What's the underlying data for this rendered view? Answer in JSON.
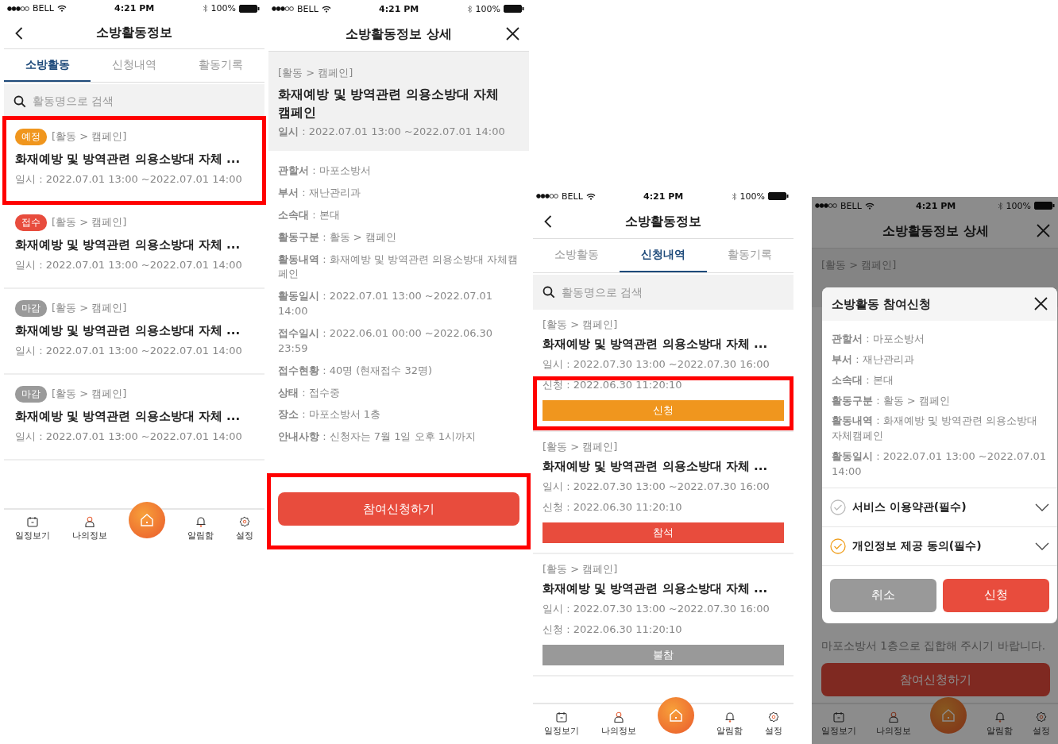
{
  "screens": [
    {
      "kind": "list",
      "status_bar": {
        "carrier": "BELL",
        "time": "4:21 PM",
        "battery": "100%"
      },
      "header": {
        "title": "소방활동정보"
      },
      "tabs": [
        {
          "label": "소방활동",
          "selected": true
        },
        {
          "label": "신청내역",
          "selected": false
        },
        {
          "label": "활동기록",
          "selected": false
        }
      ],
      "search": {
        "placeholder": "활동명으로 검색"
      },
      "items": [
        {
          "badge": "예정",
          "color": "#f0961e",
          "category": "[활동 > 캠페인]",
          "title": "화재예방 및 방역관련 의용소방대 자체 ...",
          "date": "일시 : 2022.07.01 13:00 ~2022.07.01 14:00",
          "highlighted": true
        },
        {
          "badge": "접수",
          "color": "#e84c3d",
          "category": "[활동 > 캠페인]",
          "title": "화재예방 및 방역관련 의용소방대 자체 ...",
          "date": "일시 : 2022.07.01 13:00 ~2022.07.01 14:00",
          "highlighted": false
        },
        {
          "badge": "마감",
          "color": "#9a9a9a",
          "category": "[활동 > 캠페인]",
          "title": "화재예방 및 방역관련 의용소방대 자체 ...",
          "date": "일시 : 2022.07.01 13:00 ~2022.07.01 14:00",
          "highlighted": false
        },
        {
          "badge": "마감",
          "color": "#9a9a9a",
          "category": "[활동 > 캠페인]",
          "title": "화재예방 및 방역관련 의용소방대 자체 ...",
          "date": "일시 : 2022.07.01 13:00 ~2022.07.01 14:00",
          "highlighted": false
        }
      ],
      "nav": [
        {
          "kind": "calendar",
          "label": "일정보기"
        },
        {
          "kind": "person",
          "label": "나의정보"
        },
        {
          "kind": "home"
        },
        {
          "kind": "bell",
          "label": "알림함"
        },
        {
          "kind": "gear",
          "label": "설정"
        }
      ]
    },
    {
      "kind": "detail",
      "status_bar": {
        "carrier": "BELL",
        "time": "4:21 PM",
        "battery": "100%"
      },
      "header": {
        "title": "소방활동정보 상세"
      },
      "summary": {
        "category": "[활동 > 캠페인]",
        "title": "화재예방 및 방역관련 의용소방대 자체 캠페인",
        "date": "**일시** : 2022.07.01 13:00 ~2022.07.01 14:00"
      },
      "fields": [
        "**관할서** : 마포소방서",
        "**부서** : 재난관리과",
        "**소속대** : 본대",
        "**활동구분** : 활동 > 캠페인",
        "**활동내역** : 화재예방 및 방역관련 의용소방대 자체캠페인",
        "**활동일시** : 2022.07.01 13:00 ~2022.07.01 14:00",
        "**접수일시** : 2022.06.01 00:00 ~2022.06.30 23:59",
        "**접수현황** : 40명 (현재접수 32명)",
        "**상태** : 접수중",
        "**장소** : 마포소방서 1층",
        "**안내사항** : 신청자는 7월 1일 오후 1시까지"
      ],
      "action": {
        "label": "참여신청하기",
        "highlighted": true
      }
    },
    {
      "kind": "applied",
      "status_bar": {
        "carrier": "BELL",
        "time": "4:21 PM",
        "battery": "100%"
      },
      "header": {
        "title": "소방활동정보"
      },
      "tabs": [
        {
          "label": "소방활동",
          "selected": false
        },
        {
          "label": "신청내역",
          "selected": true
        },
        {
          "label": "활동기록",
          "selected": false
        }
      ],
      "search": {
        "placeholder": "활동명으로 검색"
      },
      "items": [
        {
          "category": "[활동 > 캠페인]",
          "title": "화재예방 및 방역관련 의용소방대 자체 ...",
          "date": "일시 : 2022.07.30 13:00 ~2022.07.30 16:00",
          "applied": "신청 : 2022.06.30 11:20:10",
          "status": "신청",
          "color": "#f0961e",
          "highlighted": true
        },
        {
          "category": "[활동 > 캠페인]",
          "title": "화재예방 및 방역관련 의용소방대 자체 ...",
          "date": "일시 : 2022.07.30 13:00 ~2022.07.30 16:00",
          "applied": "신청 : 2022.06.30 11:20:10",
          "status": "참석",
          "color": "#e84c3d",
          "highlighted": false
        },
        {
          "category": "[활동 > 캠페인]",
          "title": "화재예방 및 방역관련 의용소방대 자체 ...",
          "date": "일시 : 2022.07.30 13:00 ~2022.07.30 16:00",
          "applied": "신청 : 2022.06.30 11:20:10",
          "status": "불참",
          "color": "#999999",
          "highlighted": false
        }
      ],
      "nav": [
        {
          "kind": "calendar",
          "label": "일정보기"
        },
        {
          "kind": "person",
          "label": "나의정보"
        },
        {
          "kind": "home"
        },
        {
          "kind": "bell",
          "label": "알림함"
        },
        {
          "kind": "gear",
          "label": "설정"
        }
      ]
    },
    {
      "kind": "dialog",
      "status_bar": {
        "carrier": "BELL",
        "time": "4:21 PM",
        "battery": "100%"
      },
      "header": {
        "title": "소방활동정보 상세"
      },
      "background": {
        "category": "[활동 > 캠페인]",
        "notice": "마포소방서 1층으로 집합해 주시기 바랍니다.",
        "action": "참여신청하기"
      },
      "dialog": {
        "title": "소방활동 참여신청",
        "fields": [
          "**관할서** : 마포소방서",
          "**부서** : 재난관리과",
          "**소속대** : 본대",
          "**활동구분** : 활동 > 캠페인",
          "**활동내역** : 화재예방 및 방역관련 의용소방대 자체캠페인",
          "**활동일시** : 2022.07.01 13:00 ~2022.07.01 14:00"
        ],
        "agreements": [
          {
            "label": "서비스 이용약관(필수)",
            "checked": false
          },
          {
            "label": "개인정보 제공 동의(필수)",
            "checked": true
          }
        ],
        "buttons": [
          {
            "kind": "cancel",
            "label": "취소"
          },
          {
            "kind": "confirm",
            "label": "신청"
          }
        ]
      },
      "nav": [
        {
          "kind": "calendar",
          "label": "일정보기"
        },
        {
          "kind": "person",
          "label": "나의정보"
        },
        {
          "kind": "home"
        },
        {
          "kind": "bell",
          "label": "알림함"
        },
        {
          "kind": "gear",
          "label": "설정"
        }
      ]
    }
  ]
}
